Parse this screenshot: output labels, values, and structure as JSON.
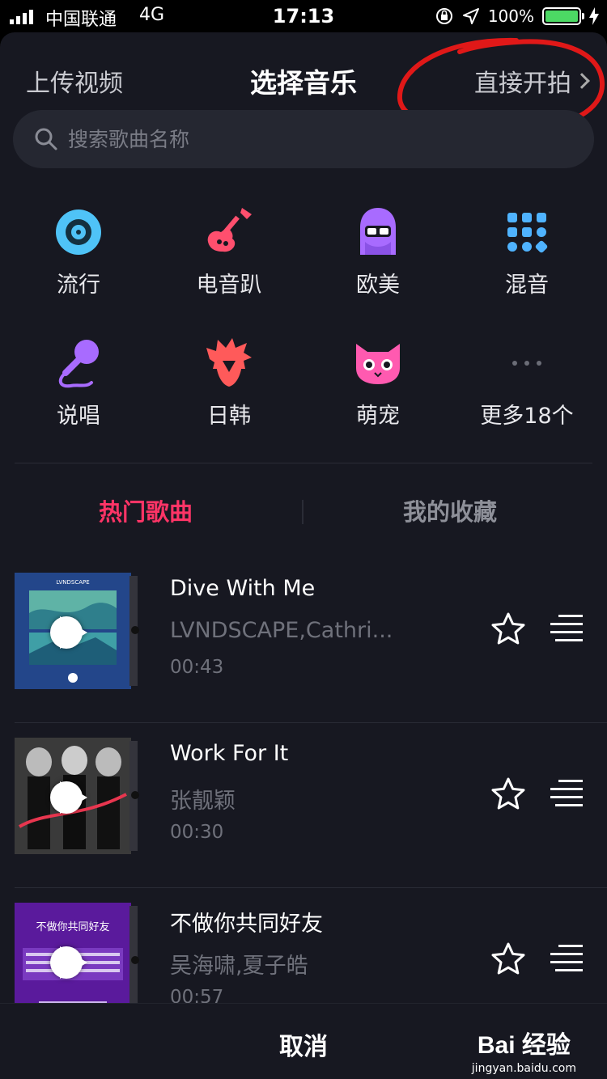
{
  "status": {
    "carrier": "中国联通",
    "network": "4G",
    "time": "17:13",
    "battery": "100%"
  },
  "header": {
    "upload_label": "上传视频",
    "title": "选择音乐",
    "shoot_label": "直接开拍"
  },
  "search": {
    "placeholder": "搜索歌曲名称"
  },
  "categories": [
    {
      "label": "流行",
      "icon": "vinyl-icon",
      "color": "#4fc3f7"
    },
    {
      "label": "电音趴",
      "icon": "guitar-icon",
      "color": "#ff4f6e"
    },
    {
      "label": "欧美",
      "icon": "sunglasses-girl-icon",
      "color": "#a86bff"
    },
    {
      "label": "混音",
      "icon": "dots-grid-icon",
      "color": "#4fb3ff"
    },
    {
      "label": "说唱",
      "icon": "microphone-icon",
      "color": "#a86bff"
    },
    {
      "label": "日韩",
      "icon": "spiky-hair-icon",
      "color": "#ff5a5a"
    },
    {
      "label": "萌宠",
      "icon": "cat-icon",
      "color": "#ff5ab0"
    },
    {
      "label": "更多18个",
      "icon": "more-dots-icon",
      "color": "#6b6d77"
    }
  ],
  "tabs": {
    "hot": "热门歌曲",
    "favorites": "我的收藏",
    "active_color": "#fe3466"
  },
  "songs": [
    {
      "title": "Dive With Me",
      "artist": "LVNDSCAPE,Cathri...",
      "duration": "00:43",
      "cover_text": "LVNDSCAPE"
    },
    {
      "title": "Work For It",
      "artist": "张靓颖",
      "duration": "00:30",
      "cover_text": ""
    },
    {
      "title": "不做你共同好友",
      "artist": "吴海啸,夏子皓",
      "duration": "00:57",
      "cover_text": "不做你共同好友"
    }
  ],
  "footer": {
    "cancel_label": "取消"
  },
  "watermark": {
    "logo": "Bai 经验",
    "url": "jingyan.baidu.com"
  }
}
